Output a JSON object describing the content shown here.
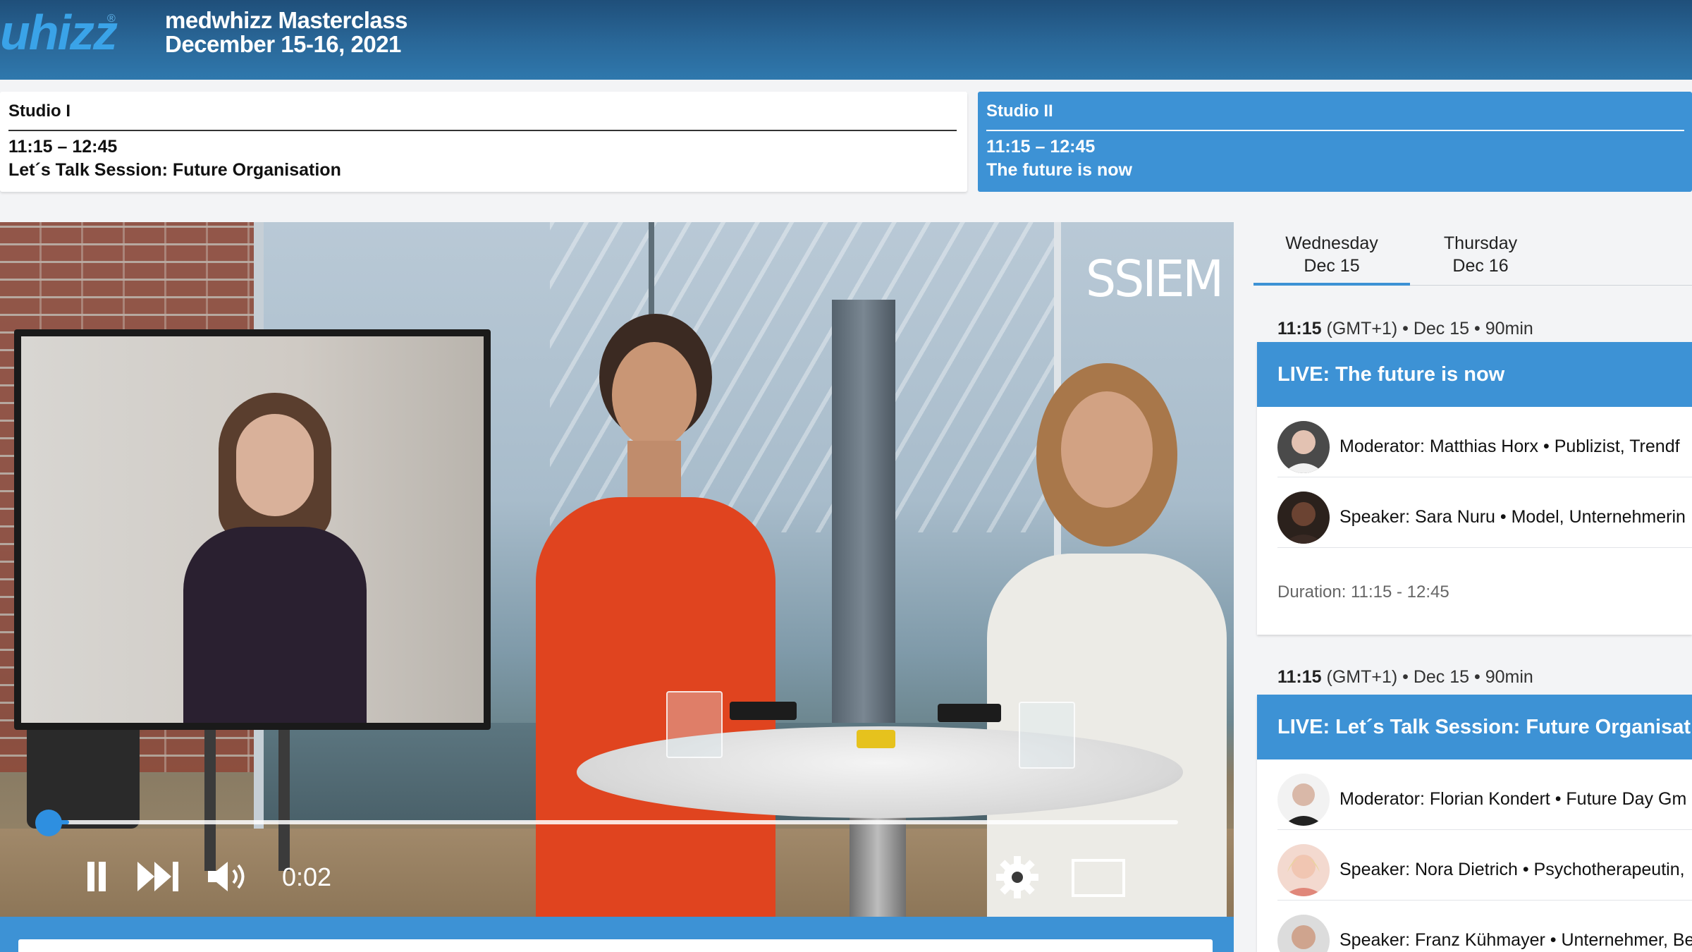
{
  "header": {
    "logo_text": "uhizz",
    "logo_mark": "®",
    "event_title": "medwhizz Masterclass",
    "event_date": "December 15-16, 2021"
  },
  "studios": [
    {
      "name": "Studio I",
      "time": "11:15 – 12:45",
      "session": "Let´s Talk Session: Future Organisation",
      "active": false
    },
    {
      "name": "Studio II",
      "time": "11:15 – 12:45",
      "session": "The future is now",
      "active": true
    }
  ],
  "video": {
    "watermark": "SSIEM",
    "current_time": "0:02",
    "progress_fraction": 0.02
  },
  "days": [
    {
      "weekday": "Wednesday",
      "date": "Dec 15",
      "selected": true
    },
    {
      "weekday": "Thursday",
      "date": "Dec 16",
      "selected": false
    }
  ],
  "sessions": [
    {
      "start": "11:15",
      "meta": " (GMT+1) • Dec 15 • 90min",
      "title": "LIVE: The future is now",
      "people": [
        "Moderator: Matthias Horx • Publizist, Trendf",
        "Speaker: Sara Nuru • Model, Unternehmerin"
      ],
      "duration": "Duration: 11:15 - 12:45"
    },
    {
      "start": "11:15",
      "meta": " (GMT+1) • Dec 15 • 90min",
      "title": "LIVE: Let´s Talk Session: Future Organisation",
      "people": [
        "Moderator: Florian Kondert • Future Day Gm",
        "Speaker: Nora Dietrich • Psychotherapeutin,",
        "Speaker: Franz Kühmayer • Unternehmer, Be"
      ]
    }
  ],
  "colors": {
    "accent": "#3d92d5",
    "header_dark": "#1f4f7a"
  }
}
